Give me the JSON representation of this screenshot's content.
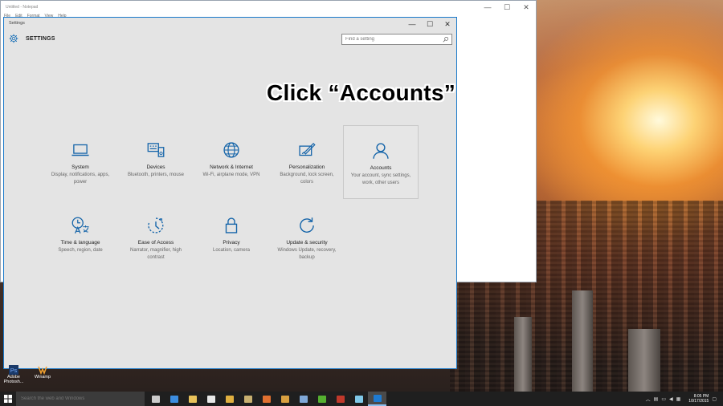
{
  "notepad": {
    "title": "Untitled - Notepad",
    "menu": [
      "File",
      "Edit",
      "Format",
      "View",
      "Help"
    ],
    "controls": {
      "minimize": "—",
      "maximize": "☐",
      "close": "✕"
    }
  },
  "settings": {
    "window_title": "Settings",
    "heading": "SETTINGS",
    "controls": {
      "minimize": "—",
      "maximize": "☐",
      "close": "✕"
    },
    "search": {
      "placeholder": "Find a setting"
    },
    "tiles": [
      {
        "title": "System",
        "desc": "Display, notifications, apps, power",
        "icon": "laptop-icon"
      },
      {
        "title": "Devices",
        "desc": "Bluetooth, printers, mouse",
        "icon": "devices-icon"
      },
      {
        "title": "Network & Internet",
        "desc": "Wi-Fi, airplane mode, VPN",
        "icon": "globe-icon"
      },
      {
        "title": "Personalization",
        "desc": "Background, lock screen, colors",
        "icon": "paintbrush-icon"
      },
      {
        "title": "Accounts",
        "desc": "Your account, sync settings, work, other users",
        "icon": "person-icon",
        "selected": true
      },
      {
        "title": "Time & language",
        "desc": "Speech, region, date",
        "icon": "time-language-icon"
      },
      {
        "title": "Ease of Access",
        "desc": "Narrator, magnifier, high contrast",
        "icon": "ease-of-access-icon"
      },
      {
        "title": "Privacy",
        "desc": "Location, camera",
        "icon": "lock-icon"
      },
      {
        "title": "Update & security",
        "desc": "Windows Update, recovery, backup",
        "icon": "refresh-icon"
      }
    ]
  },
  "overlay": {
    "caption": "Click “Accounts”"
  },
  "desktop": {
    "icons": [
      {
        "label": "Adobe Photosh...",
        "icon": "adobe-photoshop-icon"
      },
      {
        "label": "Winamp",
        "icon": "winamp-icon"
      }
    ]
  },
  "taskbar": {
    "search_placeholder": "Search the web and Windows",
    "apps": [
      {
        "icon": "task-view-icon",
        "color": "#cccccc"
      },
      {
        "icon": "edge-icon",
        "color": "#3c8de0"
      },
      {
        "icon": "file-explorer-icon",
        "color": "#e8c25a"
      },
      {
        "icon": "store-icon",
        "color": "#e8e8e8"
      },
      {
        "icon": "chrome-icon",
        "color": "#e0b040"
      },
      {
        "icon": "photos-icon",
        "color": "#c8b070"
      },
      {
        "icon": "media-icon",
        "color": "#e07030"
      },
      {
        "icon": "paint-icon",
        "color": "#d8a040"
      },
      {
        "icon": "virtualbox-icon",
        "color": "#7fa8d8"
      },
      {
        "icon": "green-app-icon",
        "color": "#55b030"
      },
      {
        "icon": "filezilla-icon",
        "color": "#c0392b"
      },
      {
        "icon": "app-icon",
        "color": "#7fc8e8"
      },
      {
        "icon": "settings-app-icon",
        "color": "#1e7ad0"
      }
    ],
    "tray_time": "8:05 PM",
    "tray_date": "10/17/2015"
  }
}
